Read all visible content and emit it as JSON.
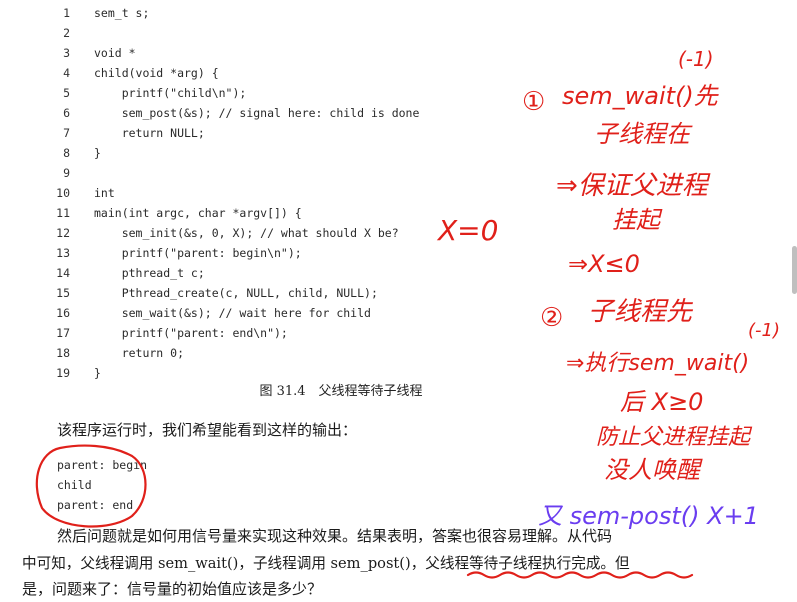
{
  "code_lines": [
    {
      "n": "1",
      "t": "sem_t s;"
    },
    {
      "n": "2",
      "t": ""
    },
    {
      "n": "3",
      "t": "void *"
    },
    {
      "n": "4",
      "t": "child(void *arg) {"
    },
    {
      "n": "5",
      "t": "    printf(\"child\\n\");"
    },
    {
      "n": "6",
      "t": "    sem_post(&s); // signal here: child is done"
    },
    {
      "n": "7",
      "t": "    return NULL;"
    },
    {
      "n": "8",
      "t": "}"
    },
    {
      "n": "9",
      "t": ""
    },
    {
      "n": "10",
      "t": "int"
    },
    {
      "n": "11",
      "t": "main(int argc, char *argv[]) {"
    },
    {
      "n": "12",
      "t": "    sem_init(&s, 0, X); // what should X be?"
    },
    {
      "n": "13",
      "t": "    printf(\"parent: begin\\n\");"
    },
    {
      "n": "14",
      "t": "    pthread_t c;"
    },
    {
      "n": "15",
      "t": "    Pthread_create(c, NULL, child, NULL);"
    },
    {
      "n": "16",
      "t": "    sem_wait(&s); // wait here for child"
    },
    {
      "n": "17",
      "t": "    printf(\"parent: end\\n\");"
    },
    {
      "n": "18",
      "t": "    return 0;"
    },
    {
      "n": "19",
      "t": "}"
    }
  ],
  "caption": "图 31.4　父线程等待子线程",
  "para1": "该程序运行时，我们希望能看到这样的输出：",
  "output_lines": [
    "parent: begin",
    "child",
    "parent: end"
  ],
  "para2_line1": "然后问题就是如何用信号量来实现这种效果。结果表明，答案也很容易理解。从代码",
  "para2_line2": "中可知，父线程调用 sem_wait()，子线程调用 sem_post()，父线程等待子线程执行完成。但",
  "para2_line3": "是，问题来了：信号量的初始值应该是多少？",
  "annotations": {
    "x_eq": "X=0",
    "a1_label": "①",
    "a1_text": "sem_wait()先",
    "a1_minus": "(-1)",
    "a1_line2": "子线程在",
    "a2_text": "⇒保证父进程",
    "a2_line2": "挂起",
    "a3_text": "⇒X≤0",
    "b_label": "②",
    "b_text": "子线程先",
    "b_exec": "⇒执行sem_wait()",
    "b_minus": "(-1)",
    "b_after": "后 X≥0",
    "b_prevent": "防止父进程挂起",
    "b_no": "没人唤醒",
    "blue": "又 sem-post() X+1"
  },
  "colors": {
    "ink_red": "#e0201a",
    "ink_blue": "#6a3df0"
  }
}
